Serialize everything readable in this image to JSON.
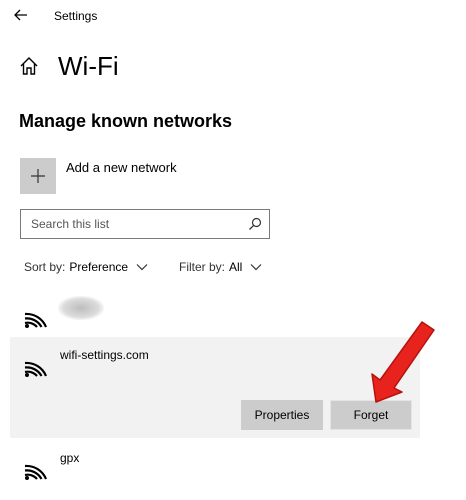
{
  "titlebar": {
    "title": "Settings"
  },
  "page": {
    "title": "Wi-Fi",
    "section_heading": "Manage known networks"
  },
  "add_network": {
    "label": "Add a new network"
  },
  "search": {
    "placeholder": "Search this list"
  },
  "sort": {
    "label": "Sort by:",
    "value": "Preference"
  },
  "filter": {
    "label": "Filter by:",
    "value": "All"
  },
  "networks": [
    {
      "name": ""
    },
    {
      "name": "wifi-settings.com",
      "buttons": {
        "properties": "Properties",
        "forget": "Forget"
      }
    },
    {
      "name": "gpx"
    }
  ],
  "icons": [
    "back-arrow-icon",
    "home-icon",
    "plus-icon",
    "search-icon",
    "chevron-down-icon",
    "wifi-icon",
    "red-arrow-annotation"
  ],
  "colors": {
    "annotation_arrow": "#e8231e",
    "selected_row": "#f2f2f2",
    "button_bg": "#cccccc"
  }
}
